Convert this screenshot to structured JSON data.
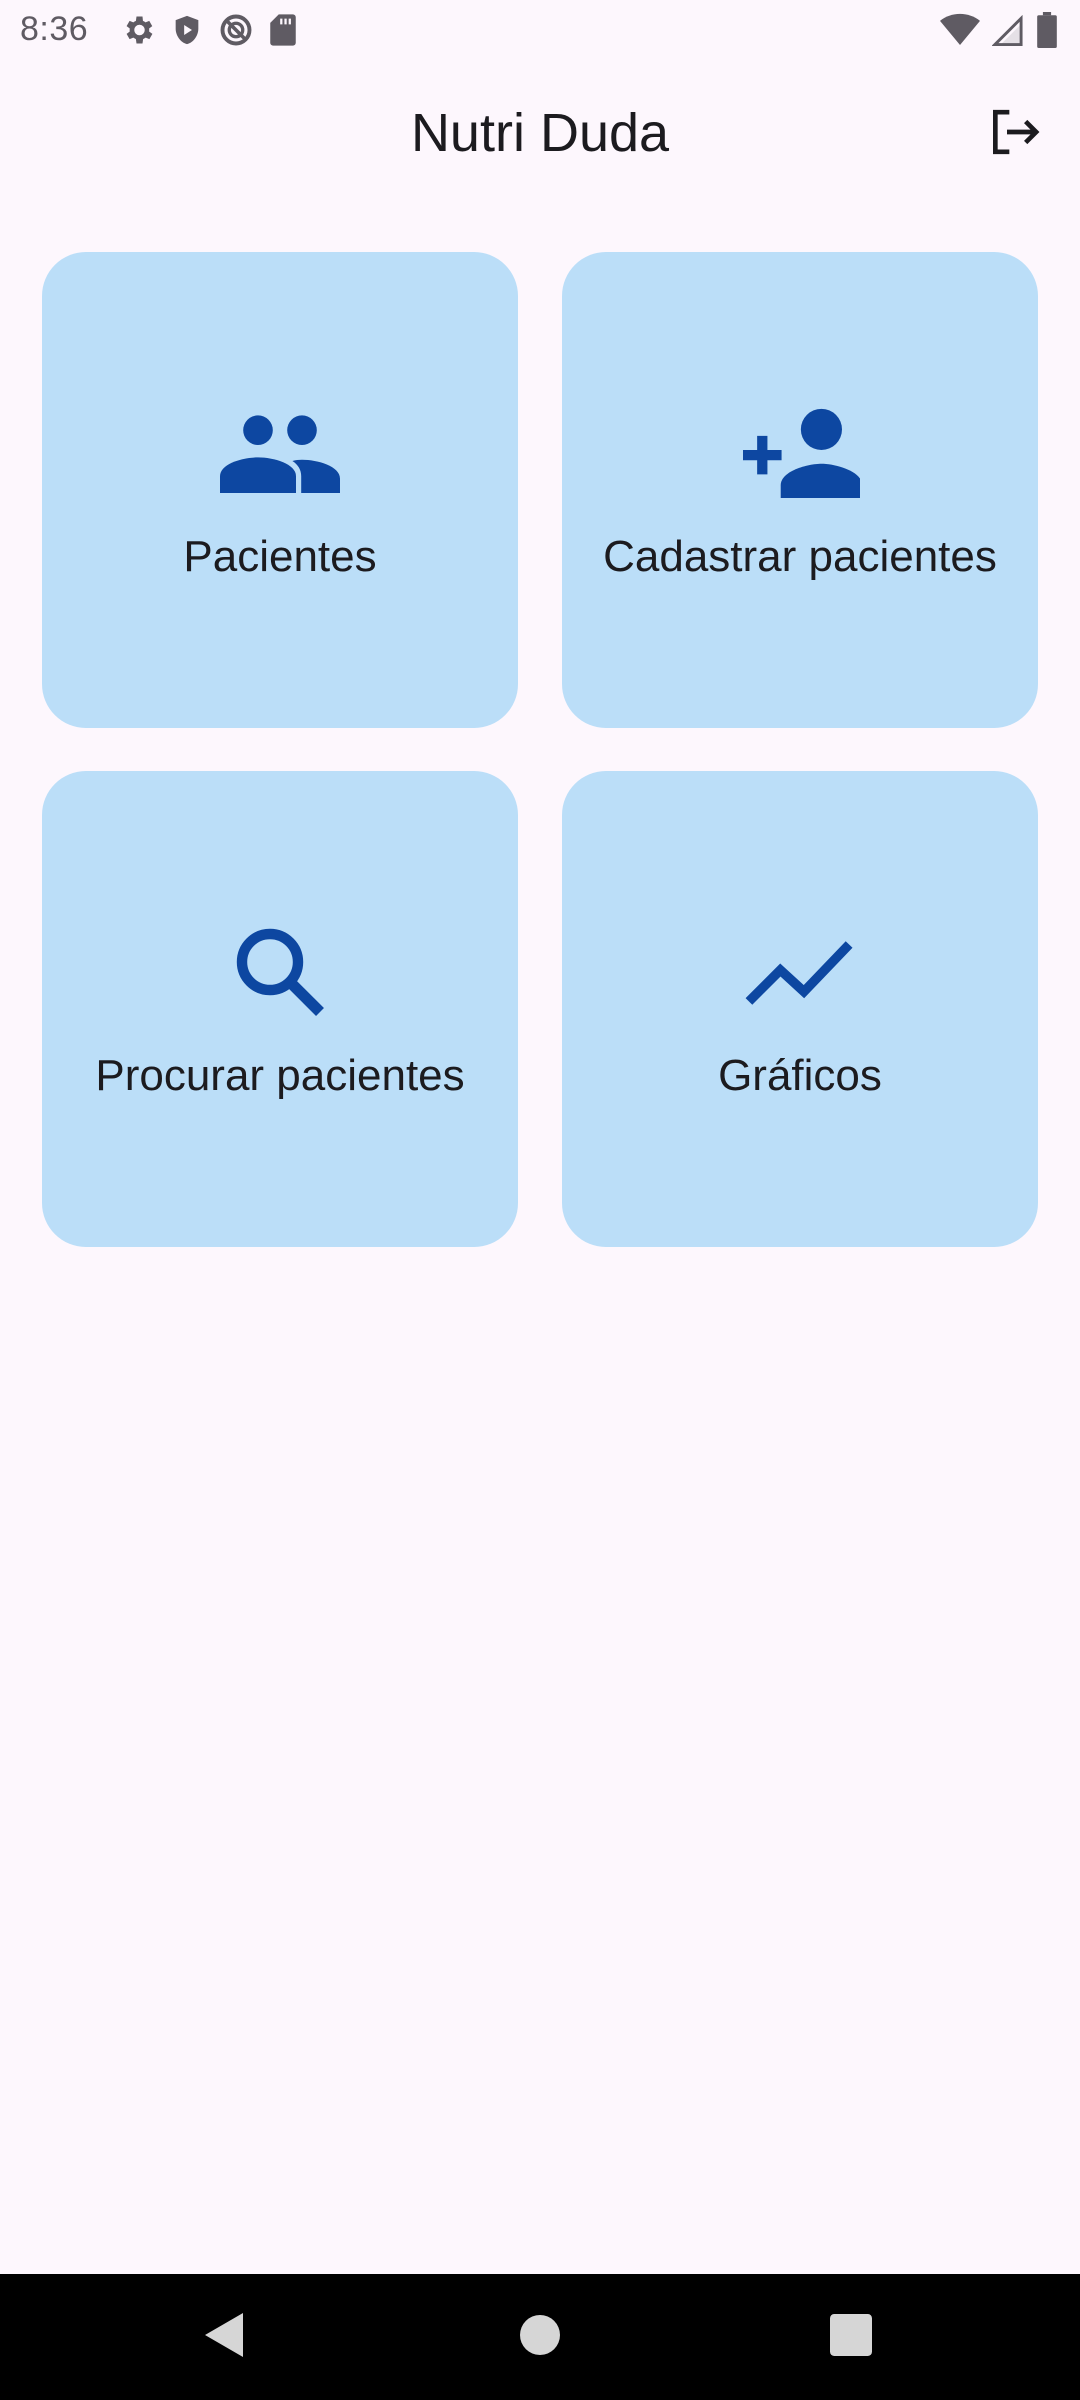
{
  "status_bar": {
    "time": "8:36",
    "left_icons": [
      "settings-icon",
      "shield-play-icon",
      "blocked-circle-icon",
      "sd-card-icon"
    ],
    "right_icons": [
      "wifi-icon",
      "cell-signal-icon",
      "battery-icon"
    ]
  },
  "app_bar": {
    "title": "Nutri Duda",
    "logout_icon": "logout-icon"
  },
  "tiles": [
    {
      "label": "Pacientes",
      "icon": "people-icon"
    },
    {
      "label": "Cadastrar pacientes",
      "icon": "person-add-icon"
    },
    {
      "label": "Procurar pacientes",
      "icon": "search-icon"
    },
    {
      "label": "Gráficos",
      "icon": "trending-up-icon"
    }
  ],
  "colors": {
    "background": "#fdf7fd",
    "tile_background": "#bbdef8",
    "icon_accent": "#0d47a1",
    "text": "#1c1b1f",
    "nav_bar": "#000000"
  },
  "nav_bar": {
    "icons": [
      "back-icon",
      "home-icon",
      "recents-icon"
    ]
  }
}
